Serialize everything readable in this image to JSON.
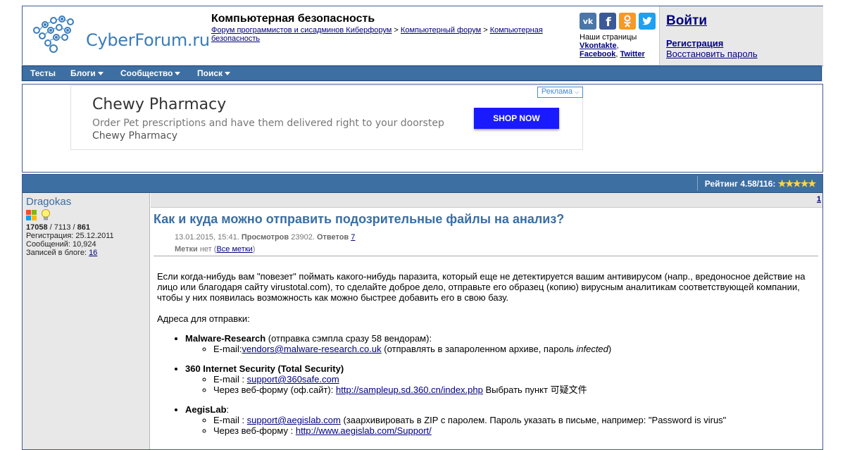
{
  "header": {
    "logo_text": "CyberForum.ru",
    "site_title": "Компьютерная безопасность",
    "breadcrumb": {
      "link1": "Форум программистов и сисадминов Киберфорум",
      "sep1": ">",
      "link2": "Компьютерный форум",
      "sep2": ">",
      "link3": "Компьютерная безопасность"
    },
    "social": {
      "vk_icon": "vk-icon",
      "fb_icon": "facebook-icon",
      "ok_icon": "odnoklassniki-icon",
      "tw_icon": "twitter-icon",
      "pages_label": "Наши страницы",
      "vk_link": "Vkontakte",
      "fb_link": "Facebook",
      "tw_link": "Twitter"
    },
    "login": {
      "login_label": "Войти",
      "register_label": "Регистрация",
      "restore_label": "Восстановить пароль"
    }
  },
  "navbar": {
    "items": [
      {
        "label": "Тесты",
        "dropdown": false
      },
      {
        "label": "Блоги",
        "dropdown": true
      },
      {
        "label": "Сообщество",
        "dropdown": true
      },
      {
        "label": "Поиск",
        "dropdown": true
      }
    ]
  },
  "ad": {
    "title": "Chewy Pharmacy",
    "description": "Order Pet prescriptions and have them delivered right to your doorstep",
    "description_brand": "Chewy Pharmacy",
    "button_label": "SHOP NOW",
    "badge_label": "Реклама"
  },
  "rating": {
    "label": "Рейтинг 4.58/116:",
    "stars": 5
  },
  "user": {
    "name": "Dragokas",
    "stat1": "17058",
    "sep": "/",
    "stat2": "7113",
    "stat3": "861",
    "registration": "Регистрация: 25.12.2011",
    "messages": "Сообщений: 10,924",
    "blog_label": "Записей в блоге:",
    "blog_count": "16"
  },
  "post": {
    "number": "1",
    "title": "Как и куда можно отправить подозрительные файлы на анализ?",
    "date": "13.01.2015, 15:41.",
    "views_label": "Просмотров",
    "views": "23902.",
    "replies_label": "Ответов",
    "replies": "7",
    "tags_label": "Метки",
    "tags_none": "нет (",
    "tags_link": "Все метки",
    "tags_close": ")",
    "intro": "Если когда-нибудь вам \"повезет\" поймать какого-нибудь паразита, который еще не детектируется вашим антивирусом (напр., вредоносное действие на лицо или благодаря сайту virustotal.com), то сделайте доброе дело, отправьте его образец (копию) вирусным аналитикам соответствующей компании, чтобы у них появилась возможность как можно быстрее добавить его в свою базу.",
    "addresses_label": "Адреса для отправки:",
    "vendors": [
      {
        "name": "Malware-Research",
        "note": " (отправка сэмпла сразу 58 вендорам):",
        "items": [
          {
            "prefix": "E-mail:",
            "link": "vendors@malware-research.co.uk",
            "suffix": " (отправлять в запароленном архиве, пароль ",
            "em": "infected",
            "suffix2": ")"
          }
        ]
      },
      {
        "name": "360 Internet Security (Total Security)",
        "note": "",
        "items": [
          {
            "prefix": "E-mail : ",
            "link": "support@360safe.com",
            "suffix": "",
            "em": "",
            "suffix2": ""
          },
          {
            "prefix": "Через веб-форму (оф.сайт): ",
            "link": "http://sampleup.sd.360.cn/index.php",
            "suffix": " Выбрать пункт 可疑文件",
            "em": "",
            "suffix2": ""
          }
        ]
      },
      {
        "name": "AegisLab",
        "note": ":",
        "items": [
          {
            "prefix": "E-mail : ",
            "link": "support@aegislab.com",
            "suffix": " (заархивировать в ZIP с паролем. Пароль указать в письме, например: \"Password is virus\"",
            "em": "",
            "suffix2": ""
          },
          {
            "prefix": "Через веб-форму : ",
            "link": "http://www.aegislab.com/Support/",
            "suffix": "",
            "em": "",
            "suffix2": ""
          }
        ]
      }
    ]
  },
  "colors": {
    "nav_bg": "#3e6fa2",
    "link": "#000080",
    "title_blue": "#3a6ea5",
    "ad_button": "#1a1aff",
    "vk": "#4a76a8",
    "facebook": "#3b5998",
    "odnoklassniki": "#f59a23",
    "twitter": "#1da1f2"
  }
}
